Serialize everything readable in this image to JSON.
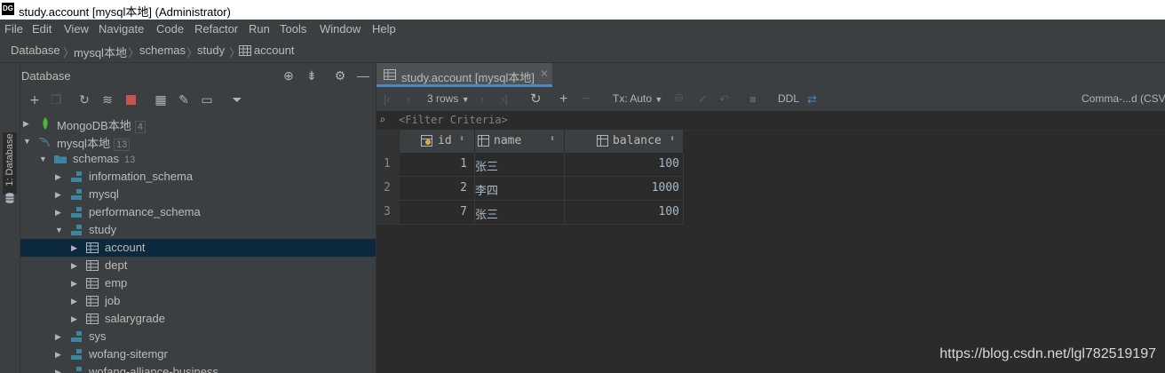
{
  "window": {
    "logo": "DG",
    "title": "study.account [mysql本地] (Administrator)"
  },
  "menu": [
    {
      "label": "File"
    },
    {
      "label": "Edit"
    },
    {
      "label": "View"
    },
    {
      "label": "Navigate"
    },
    {
      "label": "Code"
    },
    {
      "label": "Refactor"
    },
    {
      "label": "Run"
    },
    {
      "label": "Tools"
    },
    {
      "label": "Window"
    },
    {
      "label": "Help"
    }
  ],
  "breadcrumb": [
    "Database",
    "mysql本地",
    "schemas",
    "study",
    "account"
  ],
  "side_stripe": {
    "label": "1: Database"
  },
  "database_panel": {
    "title": "Database",
    "tree": [
      {
        "label": "MongoDB本地",
        "count": "4",
        "icon": "mongodb-leaf-icon"
      },
      {
        "label": "mysql本地",
        "count": "13",
        "icon": "mysql-dolphin-icon"
      },
      {
        "label": "schemas",
        "count": "13",
        "icon": "folder-icon"
      },
      {
        "label": "information_schema",
        "icon": "schema-icon"
      },
      {
        "label": "mysql",
        "icon": "schema-icon"
      },
      {
        "label": "performance_schema",
        "icon": "schema-icon"
      },
      {
        "label": "study",
        "icon": "schema-icon"
      },
      {
        "label": "account",
        "icon": "table-icon"
      },
      {
        "label": "dept",
        "icon": "table-icon"
      },
      {
        "label": "emp",
        "icon": "table-icon"
      },
      {
        "label": "job",
        "icon": "table-icon"
      },
      {
        "label": "salarygrade",
        "icon": "table-icon"
      },
      {
        "label": "sys",
        "icon": "schema-icon"
      },
      {
        "label": "wofang-sitemgr",
        "icon": "schema-icon"
      },
      {
        "label": "wofang-alliance-business",
        "icon": "schema-icon"
      }
    ]
  },
  "editor": {
    "tab_label": "study.account [mysql本地]",
    "toolbar": {
      "rows": "3 rows",
      "tx": "Tx: Auto",
      "ddl": "DDL",
      "export": "Comma-...d (CSV)"
    },
    "filter_placeholder": "<Filter Criteria>",
    "columns": [
      {
        "name": "id",
        "icon": "key-column-icon"
      },
      {
        "name": "name",
        "icon": "column-icon"
      },
      {
        "name": "balance",
        "icon": "column-icon"
      }
    ],
    "rows": [
      {
        "num": "1",
        "id": "1",
        "name": "张三",
        "balance": "100"
      },
      {
        "num": "2",
        "id": "2",
        "name": "李四",
        "balance": "1000"
      },
      {
        "num": "3",
        "id": "7",
        "name": "张三",
        "balance": "100"
      }
    ]
  },
  "watermark": "https://blog.csdn.net/lgl782519197",
  "colors": {
    "accent": "#4a88c7",
    "selection": "#0d293e",
    "stop": "#c75450",
    "edit": "#a9b7c6"
  }
}
